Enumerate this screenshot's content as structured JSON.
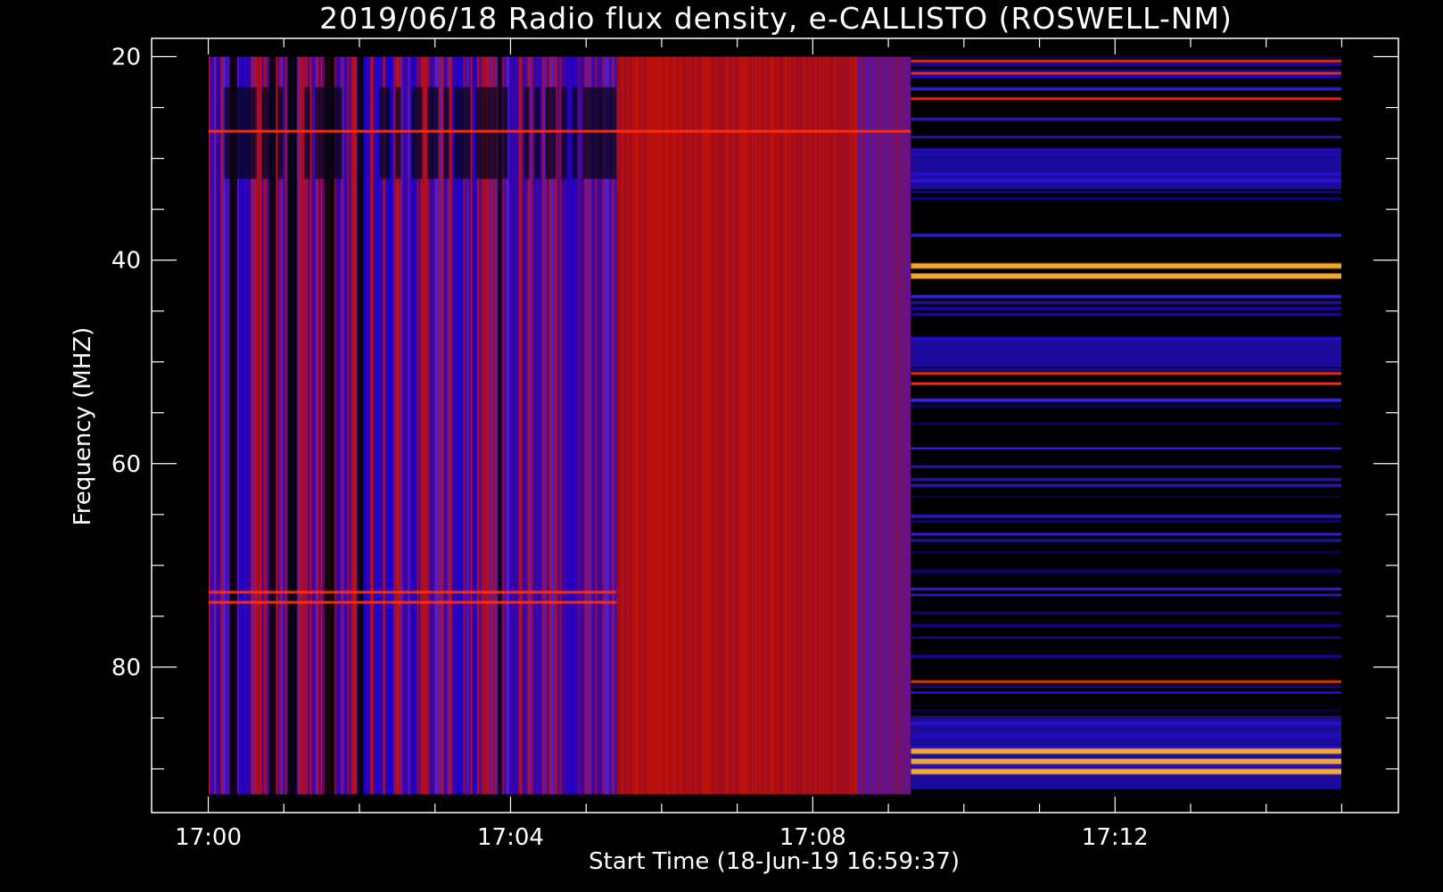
{
  "chart_data": {
    "type": "heatmap",
    "title": "2019/06/18  Radio flux density, e-CALLISTO (ROSWELL-NM)",
    "xlabel": "Start Time (18-Jun-19 16:59:37)",
    "ylabel": "Frequency (MHZ)",
    "x_ticks": [
      "17:00",
      "17:04",
      "17:08",
      "17:12"
    ],
    "x_tick_minutes": [
      0,
      4,
      8,
      12
    ],
    "xlim_minutes": [
      -0.75,
      15.75
    ],
    "y_ticks": [
      20,
      40,
      60,
      80
    ],
    "ylim": [
      18.2,
      94.3
    ],
    "y_inverted": true,
    "data_extent": {
      "t_start_minutes": 0,
      "t_end_minutes": 15,
      "f_min": 20,
      "f_max": 92.5
    },
    "segments": [
      {
        "name": "",
        "t_start_minutes": 0,
        "t_end_minutes": 5.4,
        "character": "mixed red background with strong blue/black vertical stripes"
      },
      {
        "name": "",
        "t_start_minutes": 5.4,
        "t_end_minutes": 8.6,
        "character": "mostly red background"
      },
      {
        "name": "",
        "t_start_minutes": 8.6,
        "t_end_minutes": 9.3,
        "character": "purple-red transition"
      },
      {
        "name": "",
        "t_start_minutes": 9.3,
        "t_end_minutes": 15,
        "character": "black background with horizontal interference bands"
      }
    ],
    "bright_bands_mhz": [
      20.3,
      21.5,
      24,
      27.2,
      40.3,
      41.3,
      51,
      52,
      72.5,
      73.5,
      81.3,
      88,
      89,
      90
    ],
    "colormap": [
      "#000000",
      "#1e00c8",
      "#3a22ff",
      "#9a1040",
      "#d01000",
      "#ff3000",
      "#ff9a20",
      "#ffe070"
    ]
  }
}
